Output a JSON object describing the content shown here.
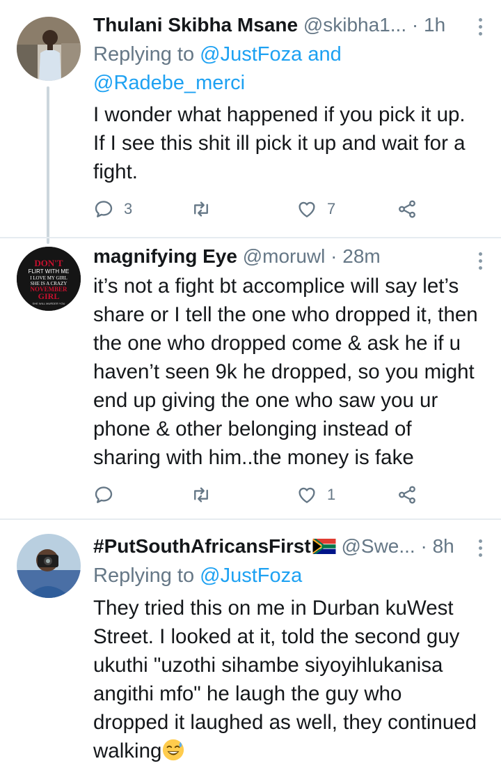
{
  "tweets": [
    {
      "name": "Thulani Skibha Msane",
      "handle": "@skibha1...",
      "time": "1h",
      "reply_prefix": "Replying to ",
      "reply_mention_1": "@JustFoza",
      "reply_and": " and",
      "reply_mention_2": "@Radebe_merci",
      "lines": [
        "I wonder what happened if you pick it up.",
        "If I see this shit ill pick it up and wait for a",
        "fight."
      ],
      "reply_count": "3",
      "retweet_count": "",
      "like_count": "7"
    },
    {
      "name": "magnifying Eye",
      "handle": "@moruwl",
      "time": "28m",
      "lines": [
        "it’s not a fight bt accomplice will say let’s",
        "share or I tell the one who dropped it, then",
        "the one who dropped come & ask he if u",
        "haven’t seen 9k he dropped, so you might",
        "end up giving the one who saw you ur",
        "phone & other belonging instead of",
        "sharing with him..the money is fake"
      ],
      "avatar_text": [
        "DON'T",
        "FLIRT WITH ME",
        "I LOVE MY GIRL",
        "SHE IS A CRAZY",
        "NOVEMBER",
        "GIRL",
        "SHE WILL MURDER YOU"
      ],
      "reply_count": "",
      "retweet_count": "",
      "like_count": "1"
    },
    {
      "name": "#PutSouthAfricansFirst",
      "handle": "@Swe...",
      "time": "8h",
      "reply_prefix": "Replying to ",
      "reply_mention_1": "@JustFoza",
      "lines": [
        "They tried this on me in Durban kuWest",
        "Street. I looked at it, told the second guy",
        "ukuthi \"uzothi sihambe siyoyihlukanisa",
        "angithi mfo\" he laugh the guy who",
        "dropped it laughed as well, they continued",
        "walking"
      ]
    }
  ],
  "separator": " · ",
  "icons": {
    "reply": "reply-icon",
    "retweet": "retweet-icon",
    "like": "heart-icon",
    "share": "share-icon",
    "more": "more-vertical-icon",
    "flag": "south-africa-flag-emoji",
    "emoji": "sweat-smile-emoji"
  },
  "colors": {
    "text": "#14171a",
    "secondary": "#657786",
    "link": "#1da1f2",
    "divider": "#e6ecf0",
    "thread_line": "#ccd6dd"
  }
}
